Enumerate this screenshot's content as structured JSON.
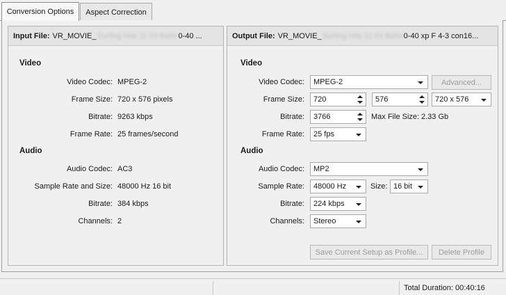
{
  "tabs": [
    {
      "label": "Conversion Options",
      "active": true
    },
    {
      "label": "Aspect Correction",
      "active": false
    }
  ],
  "input": {
    "title": "Input File:",
    "filename_prefix": "VR_MOVIE_",
    "filename_blurred": "Surfing Hite 11 03 Bahn",
    "filename_suffix": "0-40 ...",
    "video_heading": "Video",
    "audio_heading": "Audio",
    "video_rows": [
      {
        "label": "Video Codec:",
        "value": "MPEG-2"
      },
      {
        "label": "Frame Size:",
        "value": "720 x 576 pixels"
      },
      {
        "label": "Bitrate:",
        "value": "9263 kbps"
      },
      {
        "label": "Frame Rate:",
        "value": "25 frames/second"
      }
    ],
    "audio_rows": [
      {
        "label": "Audio Codec:",
        "value": "AC3"
      },
      {
        "label": "Sample Rate and Size:",
        "value": "48000 Hz 16 bit"
      },
      {
        "label": "Bitrate:",
        "value": "384 kbps"
      },
      {
        "label": "Channels:",
        "value": "2"
      }
    ]
  },
  "output": {
    "title": "Output File:",
    "filename_prefix": "VR_MOVIE_",
    "filename_blurred": "Surfing Hite 11 03 Bahn",
    "filename_suffix": "0-40 xp F 4-3 con16...",
    "video_heading": "Video",
    "audio_heading": "Audio",
    "video_codec_label": "Video Codec:",
    "video_codec_value": "MPEG-2",
    "advanced_label": "Advanced...",
    "frame_size_label": "Frame Size:",
    "frame_width": "720",
    "frame_height": "576",
    "frame_preset": "720 x 576",
    "bitrate_label": "Bitrate:",
    "bitrate_value": "3766",
    "max_file_size_label": "Max File Size:",
    "max_file_size_value": "2.33 Gb",
    "frame_rate_label": "Frame Rate:",
    "frame_rate_value": "25 fps",
    "audio_codec_label": "Audio Codec:",
    "audio_codec_value": "MP2",
    "sample_rate_label": "Sample Rate:",
    "sample_rate_value": "48000 Hz",
    "size_label": "Size:",
    "size_value": "16 bit",
    "audio_bitrate_label": "Bitrate:",
    "audio_bitrate_value": "224 kbps",
    "channels_label": "Channels:",
    "channels_value": "Stereo",
    "save_profile_label": "Save Current Setup as Profile...",
    "delete_profile_label": "Delete Profile"
  },
  "status": {
    "total_duration": "Total Duration: 00:40:16"
  },
  "colors": {
    "background": "#f0f0f0",
    "panel_header": "#e4e4e4",
    "disabled_text": "#9b9b9b"
  }
}
